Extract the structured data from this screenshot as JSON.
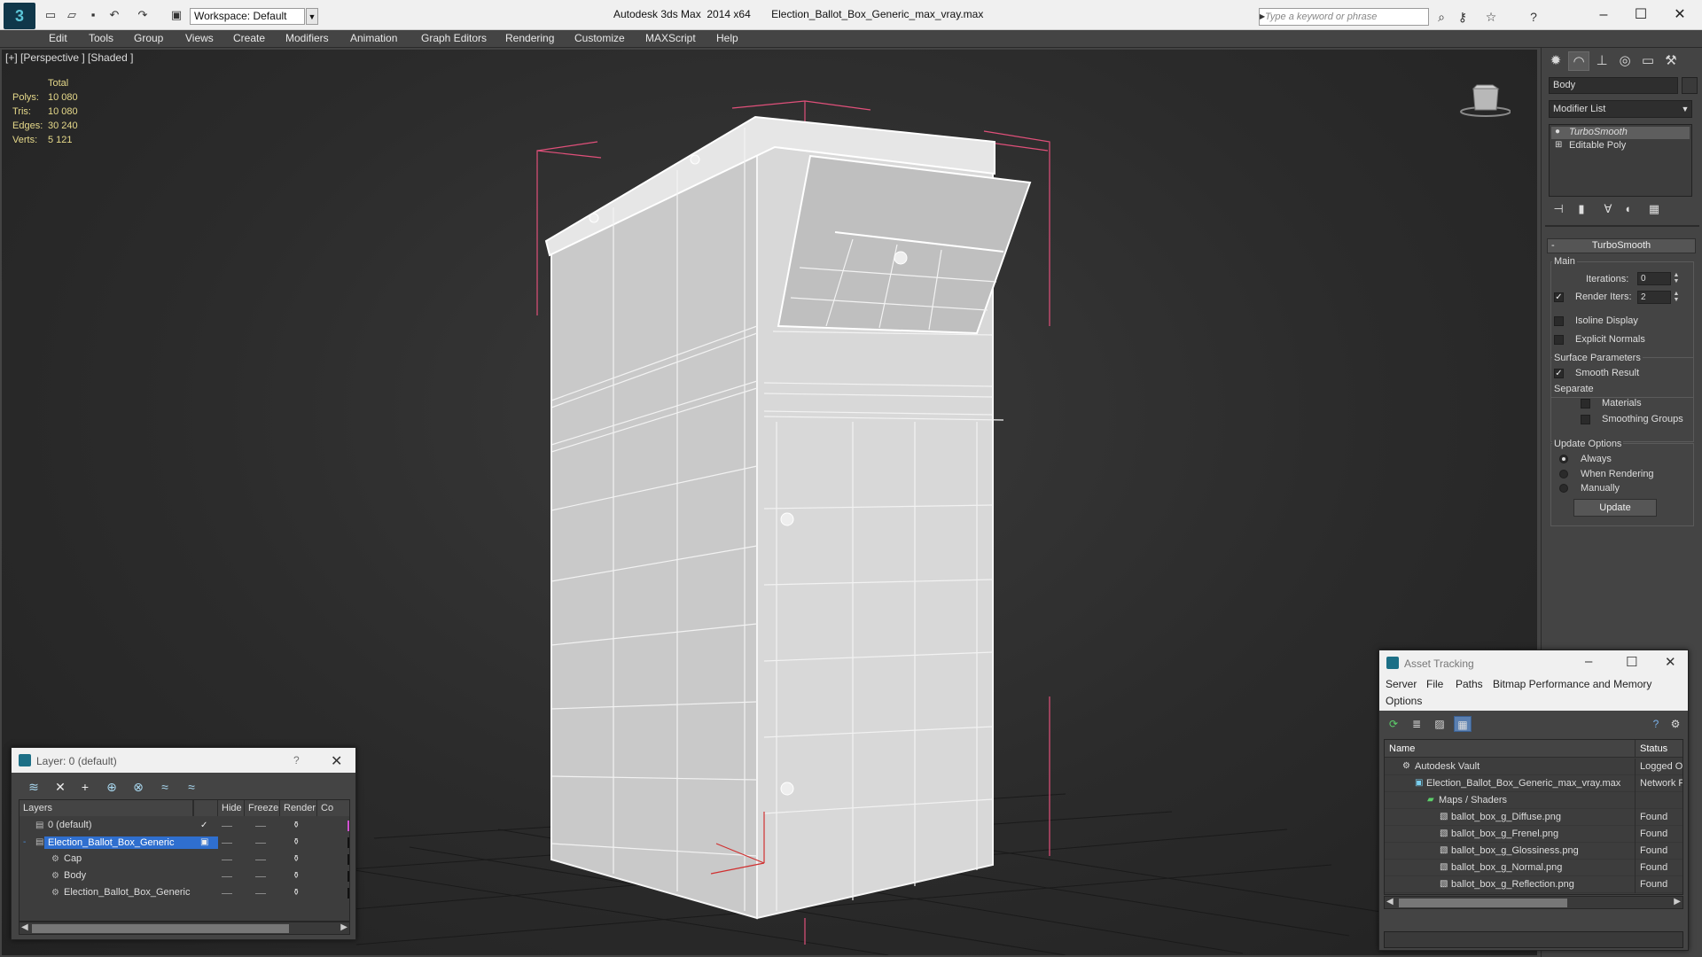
{
  "titlebar": {
    "app_logo": "3ds-max-logo",
    "workspace_label": "Workspace: Default",
    "window_title": "Autodesk 3ds Max  2014 x64       Election_Ballot_Box_Generic_max_vray.max",
    "search_placeholder": "Type a keyword or phrase"
  },
  "menubar": {
    "items": [
      "Edit",
      "Tools",
      "Group",
      "Views",
      "Create",
      "Modifiers",
      "Animation",
      "Graph Editors",
      "Rendering",
      "Customize",
      "MAXScript",
      "Help"
    ]
  },
  "viewport": {
    "label": "[+] [Perspective ] [Shaded ]",
    "stats": {
      "header": "Total",
      "rows": [
        {
          "key": "Polys:",
          "value": "10 080"
        },
        {
          "key": "Tris:",
          "value": "10 080"
        },
        {
          "key": "Edges:",
          "value": "30 240"
        },
        {
          "key": "Verts:",
          "value": "5 121"
        }
      ]
    }
  },
  "command_panel": {
    "object_name": "Body",
    "modifier_list": "Modifier List",
    "stack": [
      "TurboSmooth",
      "Editable Poly"
    ],
    "rollout_title": "TurboSmooth",
    "main_group": "Main",
    "iterations_label": "Iterations:",
    "iterations_value": "0",
    "render_iters_label": "Render Iters:",
    "render_iters_value": "2",
    "isoline_label": "Isoline Display",
    "explicit_normals_label": "Explicit Normals",
    "surface_group": "Surface Parameters",
    "smooth_result_label": "Smooth Result",
    "separate_label": "Separate",
    "materials_label": "Materials",
    "smoothing_groups_label": "Smoothing Groups",
    "update_group": "Update Options",
    "always_label": "Always",
    "when_rendering_label": "When Rendering",
    "manually_label": "Manually",
    "update_button": "Update"
  },
  "layer_dialog": {
    "title": "Layer: 0 (default)",
    "help": "?",
    "columns": [
      "Layers",
      "Hide",
      "Freeze",
      "Render",
      "Co"
    ],
    "rows": [
      {
        "name": "0 (default)"
      },
      {
        "name": "Election_Ballot_Box_Generic"
      },
      {
        "name": "Cap"
      },
      {
        "name": "Body"
      },
      {
        "name": "Election_Ballot_Box_Generic"
      }
    ]
  },
  "asset_dialog": {
    "title": "Asset Tracking",
    "menu": [
      "Server",
      "File",
      "Paths",
      "Bitmap Performance and Memory",
      "Options"
    ],
    "columns": [
      "Name",
      "Status"
    ],
    "rows": [
      {
        "name": "Autodesk Vault",
        "status": "Logged O"
      },
      {
        "name": "Election_Ballot_Box_Generic_max_vray.max",
        "status": "Network P"
      },
      {
        "name": "Maps / Shaders",
        "status": ""
      },
      {
        "name": "ballot_box_g_Diffuse.png",
        "status": "Found"
      },
      {
        "name": "ballot_box_g_Frenel.png",
        "status": "Found"
      },
      {
        "name": "ballot_box_g_Glossiness.png",
        "status": "Found"
      },
      {
        "name": "ballot_box_g_Normal.png",
        "status": "Found"
      },
      {
        "name": "ballot_box_g_Reflection.png",
        "status": "Found"
      }
    ]
  },
  "colors": {
    "accent": "#2f6fcf",
    "stats_text": "#e6d98a",
    "bounding_box": "#e0507a"
  }
}
